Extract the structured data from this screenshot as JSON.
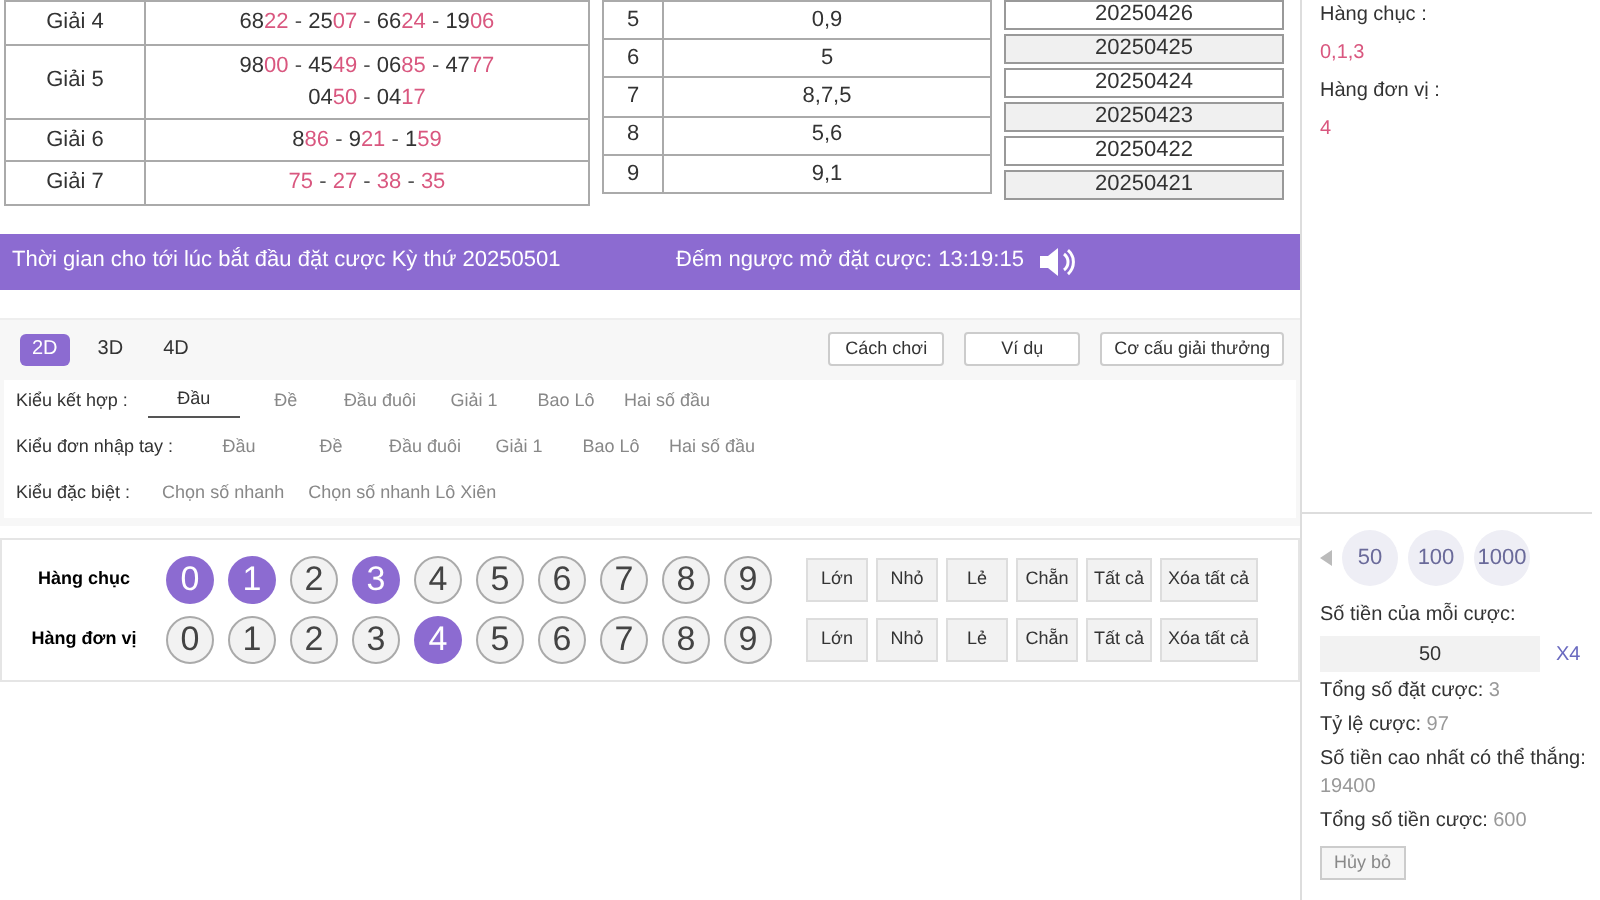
{
  "results_table": [
    {
      "label": "Giải 4",
      "lines": [
        [
          {
            "head": "68",
            "tail": "22"
          },
          {
            "head": "25",
            "tail": "07"
          },
          {
            "head": "66",
            "tail": "24"
          },
          {
            "head": "19",
            "tail": "06"
          }
        ]
      ]
    },
    {
      "label": "Giải 5",
      "lines": [
        [
          {
            "head": "98",
            "tail": "00"
          },
          {
            "head": "45",
            "tail": "49"
          },
          {
            "head": "06",
            "tail": "85"
          },
          {
            "head": "47",
            "tail": "77"
          }
        ],
        [
          {
            "head": "04",
            "tail": "50"
          },
          {
            "head": "04",
            "tail": "17"
          }
        ]
      ]
    },
    {
      "label": "Giải 6",
      "lines": [
        [
          {
            "head": "8",
            "tail": "86"
          },
          {
            "head": "9",
            "tail": "21"
          },
          {
            "head": "1",
            "tail": "59"
          }
        ]
      ]
    },
    {
      "label": "Giải 7",
      "lines": [
        [
          {
            "tail": "75"
          },
          {
            "tail": "27"
          },
          {
            "tail": "38"
          },
          {
            "tail": "35"
          }
        ]
      ]
    }
  ],
  "number_separator": "-",
  "head_table": [
    {
      "digit": "5",
      "values": "0,9"
    },
    {
      "digit": "6",
      "values": "5"
    },
    {
      "digit": "7",
      "values": "8,7,5"
    },
    {
      "digit": "8",
      "values": "5,6"
    },
    {
      "digit": "9",
      "values": "9,1"
    }
  ],
  "draw_dates": [
    {
      "date": "20250426",
      "selected": false
    },
    {
      "date": "20250425",
      "selected": true
    },
    {
      "date": "20250424",
      "selected": false
    },
    {
      "date": "20250423",
      "selected": true
    },
    {
      "date": "20250422",
      "selected": false
    },
    {
      "date": "20250421",
      "selected": true
    }
  ],
  "countdown_bar": {
    "period_text": "Thời gian cho tới lúc bắt đầu đặt cược Kỳ thứ 20250501",
    "countdown_text": "Đếm ngược mở đặt cược: 13:19:15"
  },
  "game_tabs": [
    {
      "label": "2D",
      "selected": true
    },
    {
      "label": "3D",
      "selected": false
    },
    {
      "label": "4D",
      "selected": false
    }
  ],
  "info_buttons": [
    "Cách chơi",
    "Ví dụ",
    "Cơ cấu giải thưởng"
  ],
  "bet_types": [
    {
      "label": "Kiểu kết hợp :",
      "options": [
        {
          "label": "Đầu",
          "selected": true
        },
        {
          "label": "Đề",
          "selected": false
        },
        {
          "label": "Đầu đuôi",
          "selected": false
        },
        {
          "label": "Giải 1",
          "selected": false
        },
        {
          "label": "Bao Lô",
          "selected": false
        },
        {
          "label": "Hai số đầu",
          "selected": false
        }
      ]
    },
    {
      "label": "Kiểu đơn nhập tay :",
      "options": [
        {
          "label": "Đầu",
          "selected": false
        },
        {
          "label": "Đề",
          "selected": false
        },
        {
          "label": "Đầu đuôi",
          "selected": false
        },
        {
          "label": "Giải 1",
          "selected": false
        },
        {
          "label": "Bao Lô",
          "selected": false
        },
        {
          "label": "Hai số đầu",
          "selected": false
        }
      ]
    },
    {
      "label": "Kiểu đặc biệt :",
      "options": [
        {
          "label": "Chọn số nhanh",
          "selected": false
        },
        {
          "label": "Chọn số nhanh Lô Xiên",
          "selected": false
        }
      ]
    }
  ],
  "number_picker": [
    {
      "label": "Hàng chục",
      "digits": [
        {
          "label": "0",
          "selected": true
        },
        {
          "label": "1",
          "selected": true
        },
        {
          "label": "2",
          "selected": false
        },
        {
          "label": "3",
          "selected": true
        },
        {
          "label": "4",
          "selected": false
        },
        {
          "label": "5",
          "selected": false
        },
        {
          "label": "6",
          "selected": false
        },
        {
          "label": "7",
          "selected": false
        },
        {
          "label": "8",
          "selected": false
        },
        {
          "label": "9",
          "selected": false
        }
      ],
      "quick_buttons": [
        "Lớn",
        "Nhỏ",
        "Lẻ",
        "Chẵn",
        "Tất cả",
        "Xóa tất cả"
      ]
    },
    {
      "label": "Hàng đơn vị",
      "digits": [
        {
          "label": "0",
          "selected": false
        },
        {
          "label": "1",
          "selected": false
        },
        {
          "label": "2",
          "selected": false
        },
        {
          "label": "3",
          "selected": false
        },
        {
          "label": "4",
          "selected": true
        },
        {
          "label": "5",
          "selected": false
        },
        {
          "label": "6",
          "selected": false
        },
        {
          "label": "7",
          "selected": false
        },
        {
          "label": "8",
          "selected": false
        },
        {
          "label": "9",
          "selected": false
        }
      ],
      "quick_buttons": [
        "Lớn",
        "Nhỏ",
        "Lẻ",
        "Chẵn",
        "Tất cả",
        "Xóa tất cả"
      ]
    }
  ],
  "bet_slip": {
    "picks": [
      {
        "label": "Hàng chục :",
        "value": "0,1,3"
      },
      {
        "label": "Hàng đơn vị :",
        "value": "4"
      }
    ],
    "chips": [
      "50",
      "100",
      "1000"
    ],
    "amount_label": "Số tiền của mỗi cược:",
    "amount_value": "50",
    "multiplier": "X4",
    "summary": [
      {
        "label": "Tổng số đặt cược:",
        "value": "3"
      },
      {
        "label": "Tỷ lệ cược:",
        "value": "97"
      },
      {
        "label": "Số tiền cao nhất có thể thắng:",
        "value": "19400"
      },
      {
        "label": "Tổng số tiền cược:",
        "value": "600"
      }
    ],
    "cancel_button": "Hủy bỏ"
  }
}
